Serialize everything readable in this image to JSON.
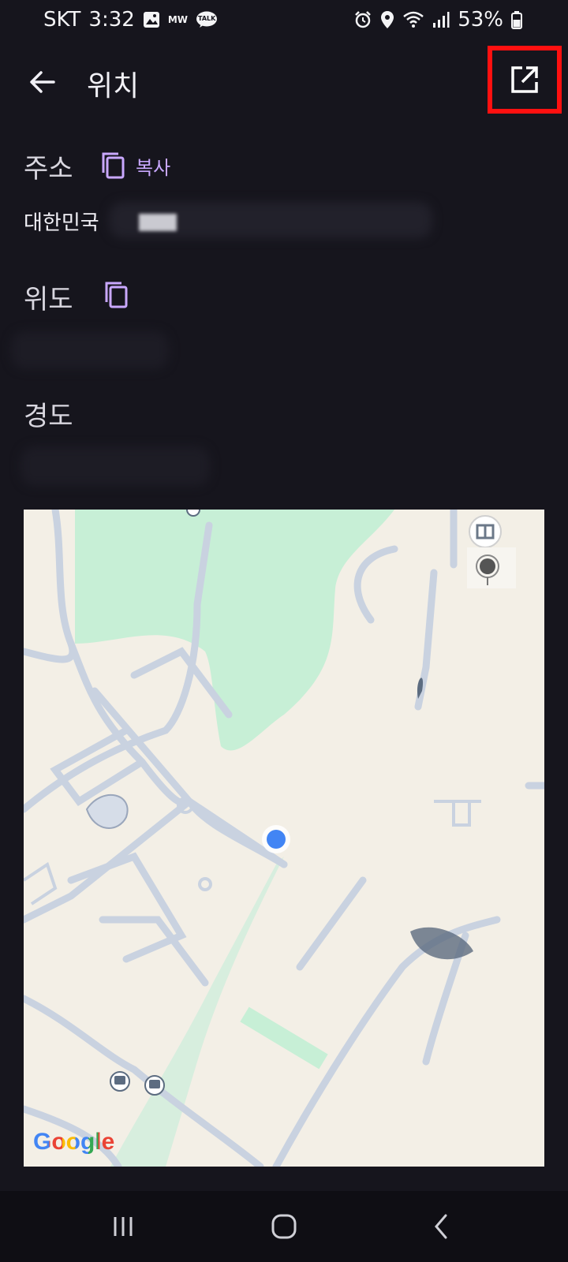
{
  "status_bar": {
    "carrier": "SKT",
    "time": "3:32",
    "notif_mw": "MW",
    "notif_talk": "TALK",
    "battery": "53%"
  },
  "app_bar": {
    "title": "위치",
    "back_icon": "arrow-left-icon",
    "open_external_icon": "open-in-new-icon"
  },
  "address": {
    "label": "주소",
    "copy_label": "복사",
    "value": "대한민국"
  },
  "latitude": {
    "label": "위도"
  },
  "longitude": {
    "label": "경도"
  },
  "map": {
    "attribution": "Google",
    "marker_color": "#4285f4",
    "park_color": "#c7efd6",
    "land_color": "#f3efe6",
    "road_color": "#c9d2e0"
  },
  "colors": {
    "background": "#16151d",
    "accent": "#c9a8ff",
    "highlight_box": "#ff1010"
  }
}
